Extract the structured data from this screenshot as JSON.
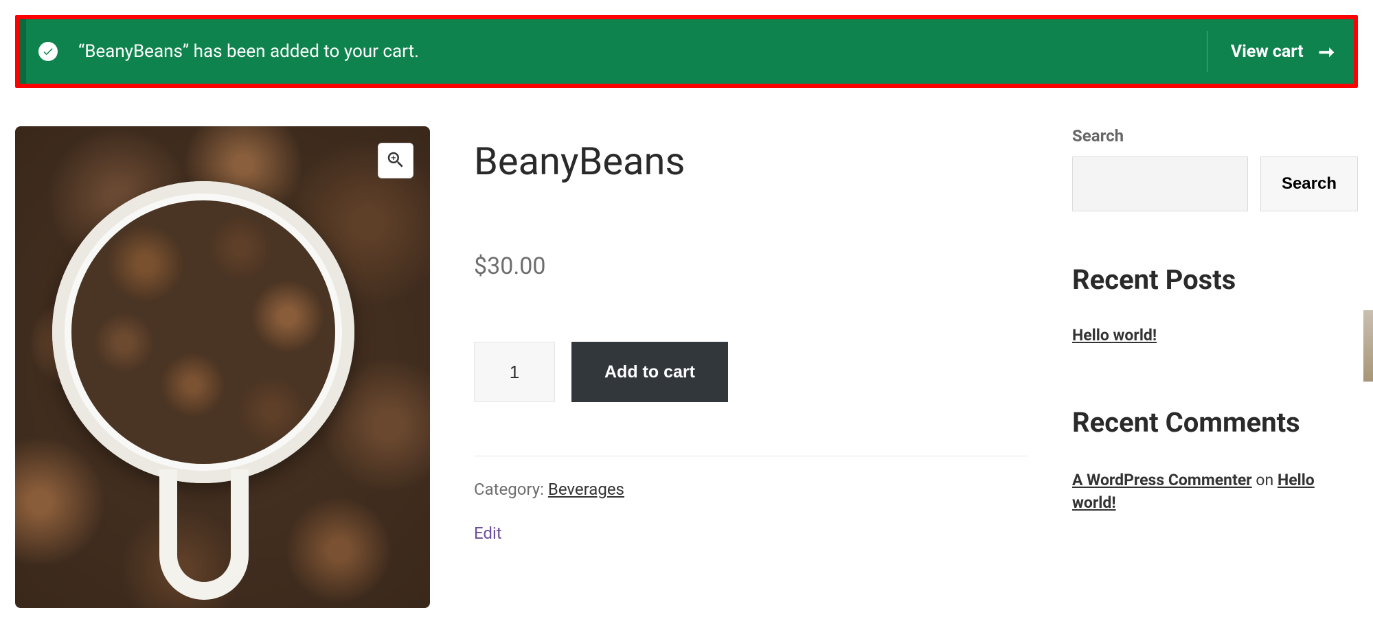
{
  "notice": {
    "message": "“BeanyBeans” has been added to your cart.",
    "action_label": "View cart"
  },
  "product": {
    "title": "BeanyBeans",
    "price_display": "$30.00",
    "quantity_value": "1",
    "add_to_cart_label": "Add to cart",
    "category_prefix": "Category: ",
    "category_name": "Beverages",
    "edit_label": "Edit"
  },
  "sidebar": {
    "search_heading": "Search",
    "search_button": "Search",
    "recent_posts_heading": "Recent Posts",
    "recent_posts": {
      "item0": "Hello world!"
    },
    "recent_comments_heading": "Recent Comments",
    "recent_comments": {
      "item0": {
        "author": "A WordPress Commenter",
        "connector": " on ",
        "target": "Hello world!"
      }
    }
  }
}
